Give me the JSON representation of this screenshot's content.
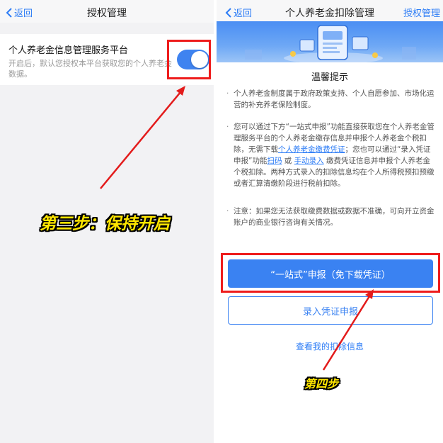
{
  "left": {
    "nav": {
      "back_label": "返回",
      "title": "授权管理"
    },
    "setting": {
      "title": "个人养老金信息管理服务平台",
      "description": "开启后，默认您授权本平台获取您的个人养老金数据。",
      "toggle_on": true
    },
    "step_label": "第三步：保持开启"
  },
  "right": {
    "nav": {
      "back_label": "返回",
      "title": "个人养老金扣除管理",
      "action_label": "授权管理"
    },
    "tips_title": "温馨提示",
    "tip_1": "个人养老金制度属于政府政策支持、个人自愿参加、市场化运营的补充养老保险制度。",
    "tip_2": {
      "part_1": "您可以通过下方“一站式申报”功能直接获取您在个人养老金管理服务平台的个人养老金缴存信息并申报个人养老金个税扣除，无需下载",
      "link_1": "个人养老金缴费凭证",
      "part_2": "；您也可以通过“录入凭证申报”功能",
      "link_2": "扫码",
      "part_3": "或",
      "link_3": "手动录入",
      "part_4": "缴费凭证信息并申报个人养老金个税扣除。两种方式录入的扣除信息均在个人所得税预扣预缴或者汇算清缴阶段进行税前扣除。"
    },
    "tip_3": "注意：如果您无法获取缴费数据或数据不准确，可向开立资金账户的商业银行咨询有关情况。",
    "primary_button": "“一站式”申报（免下载凭证）",
    "secondary_button": "录入凭证申报",
    "view_link": "查看我的扣除信息",
    "step_label": "第四步"
  },
  "colors": {
    "accent": "#3a82f2",
    "highlight": "#ee1c1c",
    "step_text": "#ffe600"
  }
}
